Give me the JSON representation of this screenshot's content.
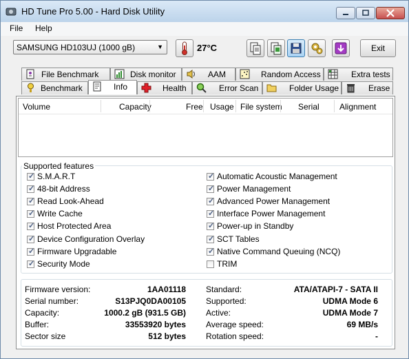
{
  "window": {
    "title": "HD Tune Pro 5.00 - Hard Disk Utility"
  },
  "menu": {
    "file": "File",
    "help": "Help"
  },
  "toolbar": {
    "drive": "SAMSUNG HD103UJ (1000 gB)",
    "temperature": "27°C",
    "exit_label": "Exit",
    "icons": [
      "thermometer-icon",
      "copy-text-icon",
      "copy-screenshot-icon",
      "save-icon",
      "options-icon",
      "exit-download-icon"
    ]
  },
  "tabs": {
    "row1": [
      {
        "label": "File Benchmark",
        "icon": "file-benchmark-icon"
      },
      {
        "label": "Disk monitor",
        "icon": "disk-monitor-icon"
      },
      {
        "label": "AAM",
        "icon": "speaker-icon"
      },
      {
        "label": "Random Access",
        "icon": "random-access-icon"
      },
      {
        "label": "Extra tests",
        "icon": "extra-tests-icon"
      }
    ],
    "row2": [
      {
        "label": "Benchmark",
        "icon": "benchmark-icon"
      },
      {
        "label": "Info",
        "icon": "info-icon",
        "active": true
      },
      {
        "label": "Health",
        "icon": "health-icon"
      },
      {
        "label": "Error Scan",
        "icon": "magnifier-icon"
      },
      {
        "label": "Folder Usage",
        "icon": "folder-icon"
      },
      {
        "label": "Erase",
        "icon": "trash-icon"
      }
    ]
  },
  "volume_table": {
    "columns": [
      "Volume",
      "Capacity",
      "Free",
      "Usage",
      "File system",
      "Serial",
      "Alignment"
    ],
    "rows": []
  },
  "features": {
    "title": "Supported features",
    "left": [
      {
        "label": "S.M.A.R.T",
        "checked": true
      },
      {
        "label": "48-bit Address",
        "checked": true
      },
      {
        "label": "Read Look-Ahead",
        "checked": true
      },
      {
        "label": "Write Cache",
        "checked": true
      },
      {
        "label": "Host Protected Area",
        "checked": true
      },
      {
        "label": "Device Configuration Overlay",
        "checked": true
      },
      {
        "label": "Firmware Upgradable",
        "checked": true
      },
      {
        "label": "Security Mode",
        "checked": true
      }
    ],
    "right": [
      {
        "label": "Automatic Acoustic Management",
        "checked": true
      },
      {
        "label": "Power Management",
        "checked": true
      },
      {
        "label": "Advanced Power Management",
        "checked": true
      },
      {
        "label": "Interface Power Management",
        "checked": true
      },
      {
        "label": "Power-up in Standby",
        "checked": true
      },
      {
        "label": "SCT Tables",
        "checked": true
      },
      {
        "label": "Native Command Queuing (NCQ)",
        "checked": true
      },
      {
        "label": "TRIM",
        "checked": false
      }
    ]
  },
  "info": {
    "left": [
      {
        "label": "Firmware version:",
        "value": "1AA01118"
      },
      {
        "label": "Serial number:",
        "value": "S13PJQ0DA00105"
      },
      {
        "label": "Capacity:",
        "value": "1000.2 gB (931.5 GB)"
      },
      {
        "label": "Buffer:",
        "value": "33553920 bytes"
      },
      {
        "label": "Sector size",
        "value": "512 bytes"
      }
    ],
    "right": [
      {
        "label": "Standard:",
        "value": "ATA/ATAPI-7 - SATA II"
      },
      {
        "label": "Supported:",
        "value": "UDMA Mode 6"
      },
      {
        "label": "Active:",
        "value": "UDMA Mode 7"
      },
      {
        "label": "Average speed:",
        "value": "69 MB/s"
      },
      {
        "label": "Rotation speed:",
        "value": "-"
      }
    ]
  },
  "colors": {
    "titlebar": "#bcd3ea",
    "checkmark": "#4d6185",
    "close_button": "#c75050"
  }
}
